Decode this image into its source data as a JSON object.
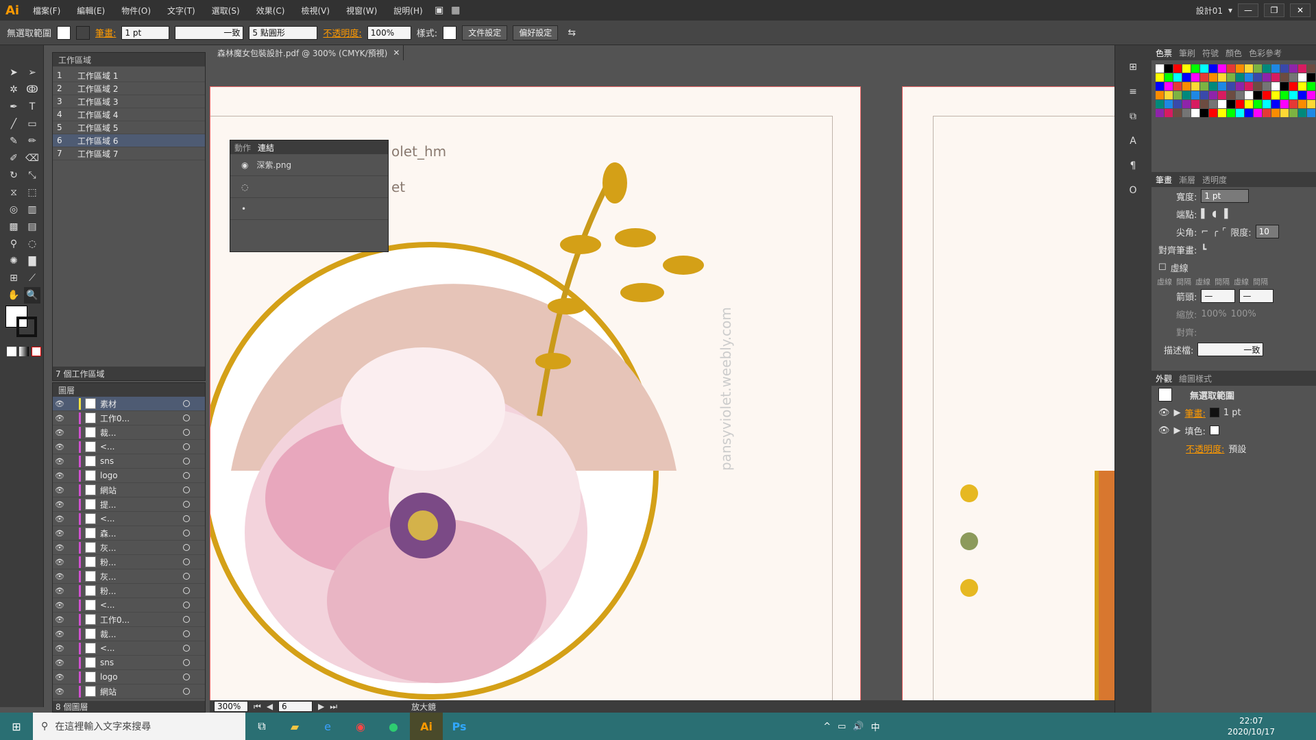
{
  "app": {
    "logo": "Ai",
    "workspace": "設計01"
  },
  "menu": [
    "檔案(F)",
    "編輯(E)",
    "物件(O)",
    "文字(T)",
    "選取(S)",
    "效果(C)",
    "檢視(V)",
    "視窗(W)",
    "說明(H)"
  ],
  "control": {
    "selection": "無選取範圍",
    "stroke_label": "筆畫:",
    "stroke_value": "1 pt",
    "stroke_profile": "一致",
    "brush": "5 點圓形",
    "opacity_label": "不透明度:",
    "opacity_value": "100%",
    "style_label": "樣式:",
    "doc_setup": "文件設定",
    "prefs": "偏好設定"
  },
  "document": {
    "tab": "森林魔女包裝設計.pdf @ 300% (CMYK/預視)"
  },
  "artboards_panel": {
    "title": "工作區域",
    "items": [
      {
        "num": "1",
        "name": "工作區域 1"
      },
      {
        "num": "2",
        "name": "工作區域 2"
      },
      {
        "num": "3",
        "name": "工作區域 3"
      },
      {
        "num": "4",
        "name": "工作區域 4"
      },
      {
        "num": "5",
        "name": "工作區域 5"
      },
      {
        "num": "6",
        "name": "工作區域 6"
      },
      {
        "num": "7",
        "name": "工作區域 7"
      }
    ],
    "footer": "7 個工作區域"
  },
  "layers_panel": {
    "title": "圖層",
    "items": [
      {
        "name": "素材",
        "color": "#f0e040"
      },
      {
        "name": "工作0...",
        "color": "#d050d0"
      },
      {
        "name": "裁...",
        "color": "#d050d0"
      },
      {
        "name": "<...",
        "color": "#d050d0"
      },
      {
        "name": "sns",
        "color": "#d050d0"
      },
      {
        "name": "logo",
        "color": "#d050d0"
      },
      {
        "name": "網站",
        "color": "#d050d0"
      },
      {
        "name": "提...",
        "color": "#d050d0"
      },
      {
        "name": "<...",
        "color": "#d050d0"
      },
      {
        "name": "森...",
        "color": "#d050d0"
      },
      {
        "name": "灰...",
        "color": "#d050d0"
      },
      {
        "name": "粉...",
        "color": "#d050d0"
      },
      {
        "name": "灰...",
        "color": "#d050d0"
      },
      {
        "name": "粉...",
        "color": "#d050d0"
      },
      {
        "name": "<...",
        "color": "#d050d0"
      },
      {
        "name": "工作0...",
        "color": "#d050d0"
      },
      {
        "name": "裁...",
        "color": "#d050d0"
      },
      {
        "name": "<...",
        "color": "#d050d0"
      },
      {
        "name": "sns",
        "color": "#d050d0"
      },
      {
        "name": "logo",
        "color": "#d050d0"
      },
      {
        "name": "網站",
        "color": "#d050d0"
      }
    ],
    "footer": "8 個圖層"
  },
  "links_panel": {
    "tab1": "動作",
    "tab2": "連結",
    "items": [
      {
        "name": "深紫.png"
      },
      {
        "name": ""
      },
      {
        "name": ""
      }
    ]
  },
  "canvas_text": {
    "text1": "olet_hm",
    "text2": "et",
    "brand": "pansyviolet",
    "vertical": "pansyviolet.weebly.com"
  },
  "status": {
    "zoom": "300%",
    "artboard": "6",
    "tool": "放大鏡"
  },
  "swatches_tabs": [
    "色票",
    "筆刷",
    "符號",
    "顏色",
    "色彩參考"
  ],
  "stroke_panel": {
    "tabs": [
      "筆畫",
      "漸層",
      "透明度"
    ],
    "width_label": "寬度:",
    "width_value": "1 pt",
    "cap_label": "端點:",
    "corner_label": "尖角:",
    "limit_label": "限度:",
    "limit_value": "10",
    "align_label": "對齊筆畫:",
    "dashed_label": "虛線",
    "dash_labels": [
      "虛線",
      "間隔",
      "虛線",
      "間隔",
      "虛線",
      "間隔"
    ],
    "arrow_label": "箭頭:",
    "scale_label": "縮放:",
    "scale1": "100%",
    "scale2": "100%",
    "align2_label": "對齊:",
    "profile_label": "描述檔:",
    "profile_value": "一致"
  },
  "appearance_panel": {
    "tabs": [
      "外觀",
      "繪圖樣式"
    ],
    "title": "無選取範圍",
    "stroke_label": "筆畫:",
    "stroke_value": "1 pt",
    "fill_label": "填色:",
    "opacity_label": "不透明度:",
    "opacity_value": "預設"
  },
  "taskbar": {
    "search_placeholder": "在這裡輸入文字來搜尋",
    "time": "22:07",
    "date": "2020/10/17",
    "ime": "中"
  },
  "colors": {
    "accent": "#ff9a00",
    "gold": "#d4a017",
    "pink": "#e6c4b8"
  }
}
